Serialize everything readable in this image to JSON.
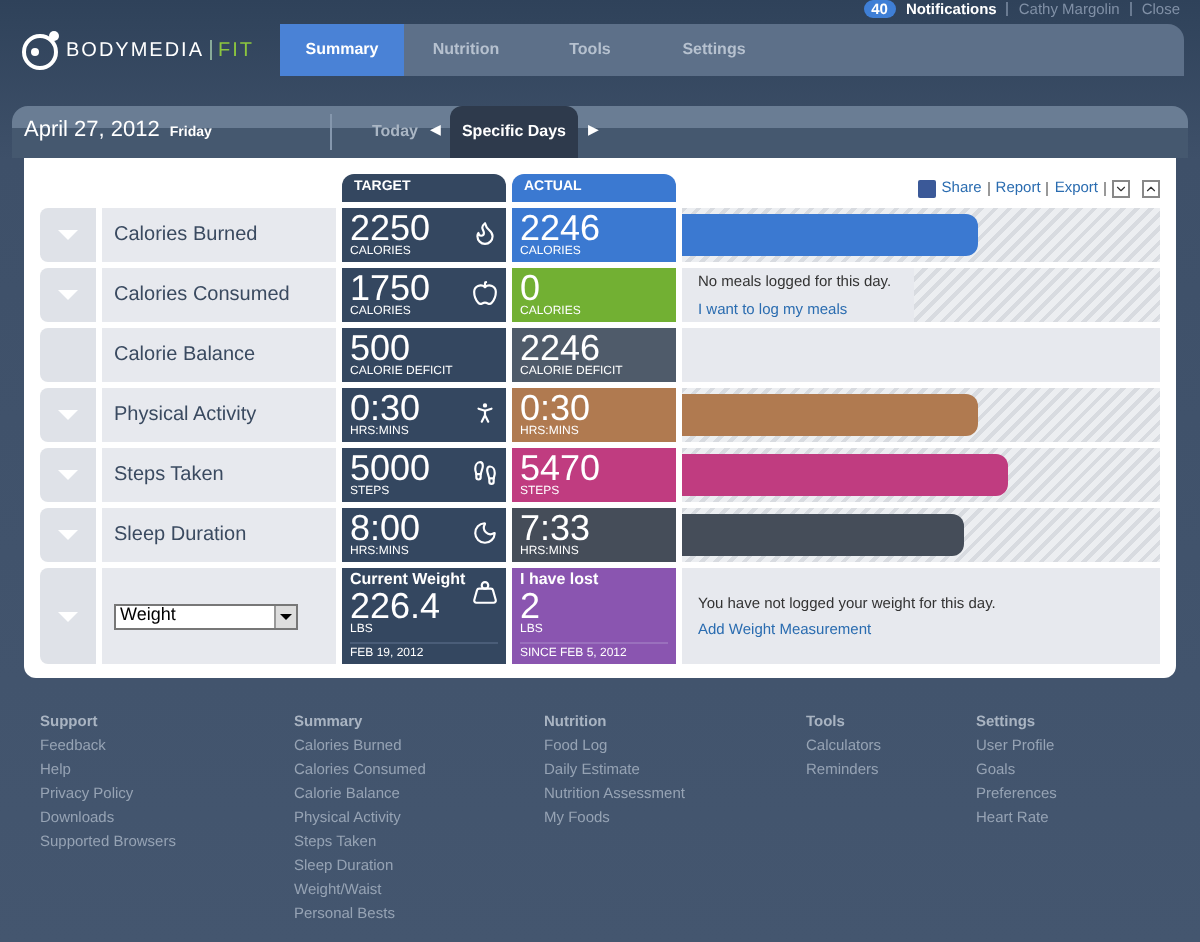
{
  "top_bar": {
    "notification_count": "40",
    "notifications": "Notifications",
    "user": "Cathy Margolin",
    "close": "Close"
  },
  "logo": {
    "brand": "BODYMEDIA",
    "product": "FIT"
  },
  "nav": [
    {
      "label": "Summary",
      "selected": true
    },
    {
      "label": "Nutrition",
      "selected": false
    },
    {
      "label": "Tools",
      "selected": false
    },
    {
      "label": "Settings",
      "selected": false
    }
  ],
  "date_bar": {
    "date": "April 27, 2012",
    "weekday": "Friday",
    "today": "Today",
    "prev": "◀",
    "mode": "Specific Days",
    "next": "▶"
  },
  "toolbar": {
    "share": "Share",
    "report": "Report",
    "export": "Export"
  },
  "columns": {
    "target": "TARGET",
    "actual": "ACTUAL"
  },
  "rows": [
    {
      "kind": "bar",
      "label": "Calories Burned",
      "expandable": true,
      "target": "2250",
      "target_unit": "CALORIES",
      "actual": "2246",
      "actual_unit": "CALORIES",
      "color": "#3b79d1",
      "level": 0.62
    },
    {
      "kind": "message",
      "label": "Calories Consumed",
      "expandable": true,
      "target": "1750",
      "target_unit": "CALORIES",
      "actual": "0",
      "actual_unit": "CALORIES",
      "color": "#72b033",
      "message": "No meals logged for this day.",
      "link": "I want to log my meals"
    },
    {
      "kind": "empty",
      "label": "Calorie Balance",
      "expandable": false,
      "target": "500",
      "target_unit": "CALORIE DEFICIT",
      "actual": "2246",
      "actual_unit": "CALORIE DEFICIT",
      "color": "#4f5b6a"
    },
    {
      "kind": "bar",
      "label": "Physical Activity",
      "expandable": true,
      "target": "0:30",
      "target_unit": "HRS:MINS",
      "actual": "0:30",
      "actual_unit": "HRS:MINS",
      "color": "#b07a50",
      "level": 0.62
    },
    {
      "kind": "bar",
      "label": "Steps Taken",
      "expandable": true,
      "target": "5000",
      "target_unit": "STEPS",
      "actual": "5470",
      "actual_unit": "STEPS",
      "color": "#c03c80",
      "level": 0.68
    },
    {
      "kind": "bar",
      "label": "Sleep Duration",
      "expandable": true,
      "target": "8:00",
      "target_unit": "HRS:MINS",
      "actual": "7:33",
      "actual_unit": "HRS:MINS",
      "color": "#454d59",
      "level": 0.59
    },
    {
      "kind": "weight",
      "select": "Weight",
      "expandable": true,
      "target_title": "Current Weight",
      "target": "226.4",
      "target_unit": "LBS",
      "target_date": "FEB 19, 2012",
      "actual_title": "I have lost",
      "actual": "2",
      "actual_unit": "LBS",
      "actual_date": "SINCE FEB 5, 2012",
      "color": "#8a55b0",
      "message": "You have not logged your weight for this day.",
      "link": "Add Weight Measurement"
    }
  ],
  "footer": [
    {
      "heading": "Support",
      "links": [
        "Feedback",
        "Help",
        "Privacy Policy",
        "Downloads",
        "Supported Browsers"
      ]
    },
    {
      "heading": "Summary",
      "links": [
        "Calories Burned",
        "Calories Consumed",
        "Calorie Balance",
        "Physical Activity",
        "Steps Taken",
        "Sleep Duration",
        "Weight/Waist",
        "Personal Bests"
      ]
    },
    {
      "heading": "Nutrition",
      "links": [
        "Food Log",
        "Daily Estimate",
        "Nutrition Assessment",
        "My Foods"
      ]
    },
    {
      "heading": "Tools",
      "links": [
        "Calculators",
        "Reminders"
      ]
    },
    {
      "heading": "Settings",
      "links": [
        "User Profile",
        "Goals",
        "Preferences",
        "Heart Rate"
      ]
    }
  ]
}
